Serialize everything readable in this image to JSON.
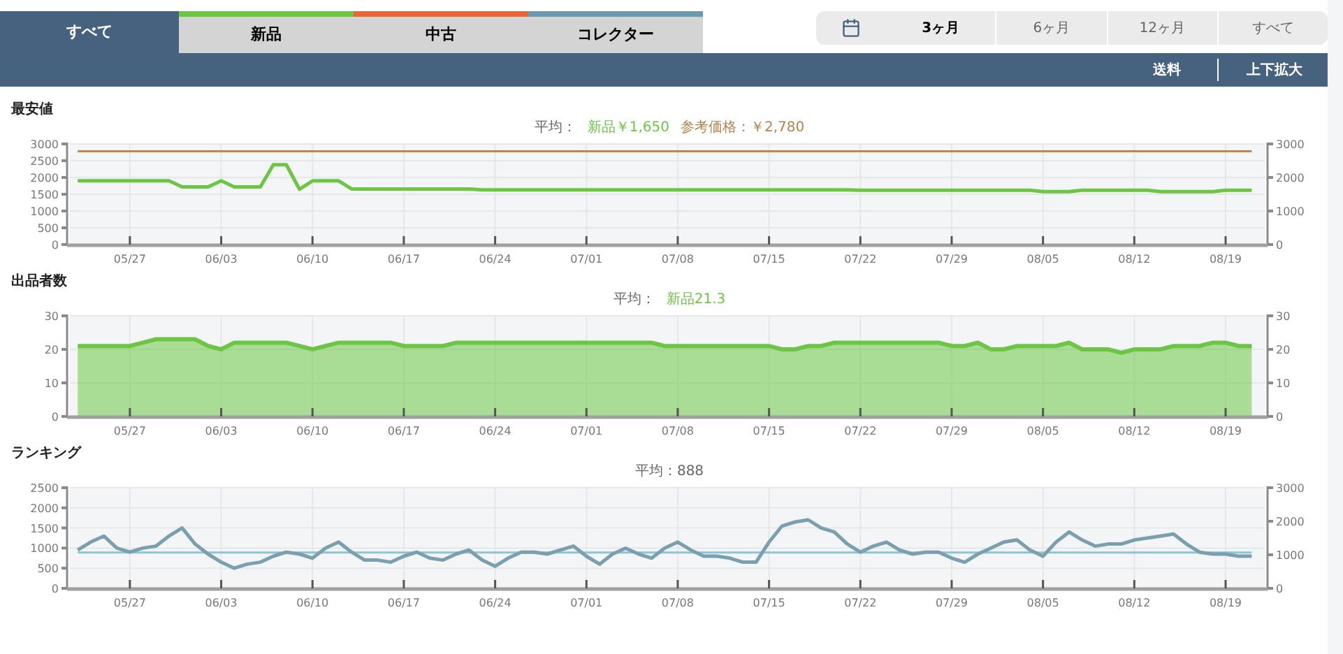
{
  "tabs": [
    {
      "label": "すべて",
      "selected": true
    },
    {
      "label": "新品",
      "selected": false,
      "color": "#6cc644"
    },
    {
      "label": "中古",
      "selected": false,
      "color": "#e8663a"
    },
    {
      "label": "コレクター",
      "selected": false,
      "color": "#6a9ab0"
    }
  ],
  "periods": [
    {
      "label": "3ヶ月",
      "selected": true
    },
    {
      "label": "6ヶ月",
      "selected": false
    },
    {
      "label": "12ヶ月",
      "selected": false
    },
    {
      "label": "すべて",
      "selected": false
    }
  ],
  "toolbar": [
    "送料",
    "上下拡大"
  ],
  "sections": [
    {
      "title": "最安値",
      "average": [
        {
          "kind": "label",
          "text": "平均："
        },
        {
          "kind": "new",
          "text": "新品￥1,650"
        },
        {
          "kind": "reference",
          "text": "参考価格：￥2,780"
        }
      ],
      "chart_data": {
        "type": "line",
        "grid": true,
        "ylim": [
          0,
          3000
        ],
        "y2lim": [
          0,
          3000
        ],
        "categories": [
          null,
          null,
          null,
          null,
          "05/27",
          null,
          null,
          null,
          null,
          null,
          null,
          "06/03",
          null,
          null,
          null,
          null,
          null,
          null,
          "06/10",
          null,
          null,
          null,
          null,
          null,
          null,
          "06/17",
          null,
          null,
          null,
          null,
          null,
          null,
          "06/24",
          null,
          null,
          null,
          null,
          null,
          null,
          "07/01",
          null,
          null,
          null,
          null,
          null,
          null,
          "07/08",
          null,
          null,
          null,
          null,
          null,
          null,
          "07/15",
          null,
          null,
          null,
          null,
          null,
          null,
          "07/22",
          null,
          null,
          null,
          null,
          null,
          null,
          "07/29",
          null,
          null,
          null,
          null,
          null,
          null,
          "08/05",
          null,
          null,
          null,
          null,
          null,
          null,
          "08/12",
          null,
          null,
          null,
          null,
          null,
          null,
          "08/19",
          null,
          null
        ],
        "yticks": [
          0,
          500,
          1000,
          1500,
          2000,
          2500,
          3000
        ],
        "y2ticks": [
          0,
          1000,
          2000,
          3000
        ],
        "series": [
          {
            "color": "#6cc644",
            "values": [
              1900,
              1900,
              1900,
              1900,
              1900,
              1900,
              1900,
              1900,
              1720,
              1720,
              1720,
              1900,
              1720,
              1720,
              1720,
              2380,
              2380,
              1650,
              1900,
              1900,
              1900,
              1660,
              1660,
              1660,
              1660,
              1660,
              1660,
              1660,
              1660,
              1660,
              1660,
              1630,
              1630,
              1630,
              1630,
              1630,
              1630,
              1630,
              1630,
              1630,
              1630,
              1630,
              1630,
              1630,
              1630,
              1630,
              1630,
              1630,
              1630,
              1630,
              1630,
              1630,
              1630,
              1630,
              1630,
              1630,
              1630,
              1630,
              1630,
              1630,
              1620,
              1620,
              1620,
              1620,
              1620,
              1620,
              1620,
              1620,
              1620,
              1620,
              1620,
              1620,
              1620,
              1620,
              1580,
              1580,
              1580,
              1620,
              1620,
              1620,
              1620,
              1620,
              1620,
              1580,
              1580,
              1580,
              1580,
              1580,
              1620,
              1620,
              1620
            ]
          },
          {
            "color": "#c08a3e",
            "values": [
              2780,
              2780,
              2780,
              2780,
              2780,
              2780,
              2780,
              2780,
              2780,
              2780,
              2780,
              2780,
              2780,
              2780,
              2780,
              2780,
              2780,
              2780,
              2780,
              2780,
              2780,
              2780,
              2780,
              2780,
              2780,
              2780,
              2780,
              2780,
              2780,
              2780,
              2780,
              2780,
              2780,
              2780,
              2780,
              2780,
              2780,
              2780,
              2780,
              2780,
              2780,
              2780,
              2780,
              2780,
              2780,
              2780,
              2780,
              2780,
              2780,
              2780,
              2780,
              2780,
              2780,
              2780,
              2780,
              2780,
              2780,
              2780,
              2780,
              2780,
              2780,
              2780,
              2780,
              2780,
              2780,
              2780,
              2780,
              2780,
              2780,
              2780,
              2780,
              2780,
              2780,
              2780,
              2780,
              2780,
              2780,
              2780,
              2780,
              2780,
              2780,
              2780,
              2780,
              2780,
              2780,
              2780,
              2780,
              2780,
              2780,
              2780,
              2780
            ]
          }
        ]
      }
    },
    {
      "title": "出品者数",
      "average": [
        {
          "kind": "label",
          "text": "平均："
        },
        {
          "kind": "new",
          "text": "新品21.3"
        }
      ],
      "chart_data": {
        "type": "area",
        "grid": true,
        "ylim": [
          0,
          30
        ],
        "y2lim": [
          0,
          30
        ],
        "categories": [
          null,
          null,
          null,
          null,
          "05/27",
          null,
          null,
          null,
          null,
          null,
          null,
          "06/03",
          null,
          null,
          null,
          null,
          null,
          null,
          "06/10",
          null,
          null,
          null,
          null,
          null,
          null,
          "06/17",
          null,
          null,
          null,
          null,
          null,
          null,
          "06/24",
          null,
          null,
          null,
          null,
          null,
          null,
          "07/01",
          null,
          null,
          null,
          null,
          null,
          null,
          "07/08",
          null,
          null,
          null,
          null,
          null,
          null,
          "07/15",
          null,
          null,
          null,
          null,
          null,
          null,
          "07/22",
          null,
          null,
          null,
          null,
          null,
          null,
          "07/29",
          null,
          null,
          null,
          null,
          null,
          null,
          "08/05",
          null,
          null,
          null,
          null,
          null,
          null,
          "08/12",
          null,
          null,
          null,
          null,
          null,
          null,
          "08/19",
          null,
          null
        ],
        "yticks": [
          0,
          10,
          20,
          30
        ],
        "y2ticks": [
          0,
          10,
          20,
          30
        ],
        "series": [
          {
            "color": "#6cc644",
            "values": [
              21,
              21,
              21,
              21,
              21,
              22,
              23,
              23,
              23,
              23,
              21,
              20,
              22,
              22,
              22,
              22,
              22,
              21,
              20,
              21,
              22,
              22,
              22,
              22,
              22,
              21,
              21,
              21,
              21,
              22,
              22,
              22,
              22,
              22,
              22,
              22,
              22,
              22,
              22,
              22,
              22,
              22,
              22,
              22,
              22,
              21,
              21,
              21,
              21,
              21,
              21,
              21,
              21,
              21,
              20,
              20,
              21,
              21,
              22,
              22,
              22,
              22,
              22,
              22,
              22,
              22,
              22,
              21,
              21,
              22,
              20,
              20,
              21,
              21,
              21,
              21,
              22,
              20,
              20,
              20,
              19,
              20,
              20,
              20,
              21,
              21,
              21,
              22,
              22,
              21,
              21
            ]
          }
        ]
      }
    },
    {
      "title": "ランキング",
      "average": [
        {
          "kind": "label",
          "text": "平均：888"
        }
      ],
      "chart_data": {
        "type": "line",
        "grid": true,
        "ylim": [
          0,
          2500
        ],
        "y2lim": [
          0,
          3000
        ],
        "categories": [
          null,
          null,
          null,
          null,
          "05/27",
          null,
          null,
          null,
          null,
          null,
          null,
          "06/03",
          null,
          null,
          null,
          null,
          null,
          null,
          "06/10",
          null,
          null,
          null,
          null,
          null,
          null,
          "06/17",
          null,
          null,
          null,
          null,
          null,
          null,
          "06/24",
          null,
          null,
          null,
          null,
          null,
          null,
          "07/01",
          null,
          null,
          null,
          null,
          null,
          null,
          "07/08",
          null,
          null,
          null,
          null,
          null,
          null,
          "07/15",
          null,
          null,
          null,
          null,
          null,
          null,
          "07/22",
          null,
          null,
          null,
          null,
          null,
          null,
          "07/29",
          null,
          null,
          null,
          null,
          null,
          null,
          "08/05",
          null,
          null,
          null,
          null,
          null,
          null,
          "08/12",
          null,
          null,
          null,
          null,
          null,
          null,
          "08/19",
          null,
          null
        ],
        "yticks": [
          0,
          500,
          1000,
          1500,
          2000,
          2500
        ],
        "y2ticks": [
          0,
          1000,
          2000,
          3000
        ],
        "series": [
          {
            "color": "#7aa0b0",
            "values": [
              950,
              1150,
              1300,
              1000,
              900,
              1000,
              1050,
              1300,
              1500,
              1100,
              850,
              650,
              500,
              600,
              650,
              800,
              900,
              850,
              750,
              1000,
              1150,
              900,
              700,
              700,
              650,
              800,
              900,
              750,
              700,
              850,
              950,
              700,
              550,
              750,
              900,
              900,
              850,
              950,
              1050,
              800,
              600,
              850,
              1000,
              850,
              750,
              1000,
              1150,
              950,
              800,
              800,
              750,
              650,
              650,
              1150,
              1550,
              1650,
              1700,
              1500,
              1400,
              1100,
              900,
              1050,
              1150,
              950,
              850,
              900,
              900,
              750,
              650,
              850,
              1000,
              1150,
              1200,
              950,
              800,
              1150,
              1400,
              1200,
              1050,
              1100,
              1100,
              1200,
              1250,
              1300,
              1350,
              1100,
              900,
              850,
              850,
              800,
              800
            ]
          },
          {
            "color": "#8ec5d6",
            "values": [
              888,
              888,
              888,
              888,
              888,
              888,
              888,
              888,
              888,
              888,
              888,
              888,
              888,
              888,
              888,
              888,
              888,
              888,
              888,
              888,
              888,
              888,
              888,
              888,
              888,
              888,
              888,
              888,
              888,
              888,
              888,
              888,
              888,
              888,
              888,
              888,
              888,
              888,
              888,
              888,
              888,
              888,
              888,
              888,
              888,
              888,
              888,
              888,
              888,
              888,
              888,
              888,
              888,
              888,
              888,
              888,
              888,
              888,
              888,
              888,
              888,
              888,
              888,
              888,
              888,
              888,
              888,
              888,
              888,
              888,
              888,
              888,
              888,
              888,
              888,
              888,
              888,
              888,
              888,
              888,
              888,
              888,
              888,
              888,
              888,
              888,
              888,
              888,
              888,
              888,
              888
            ]
          }
        ]
      }
    }
  ]
}
